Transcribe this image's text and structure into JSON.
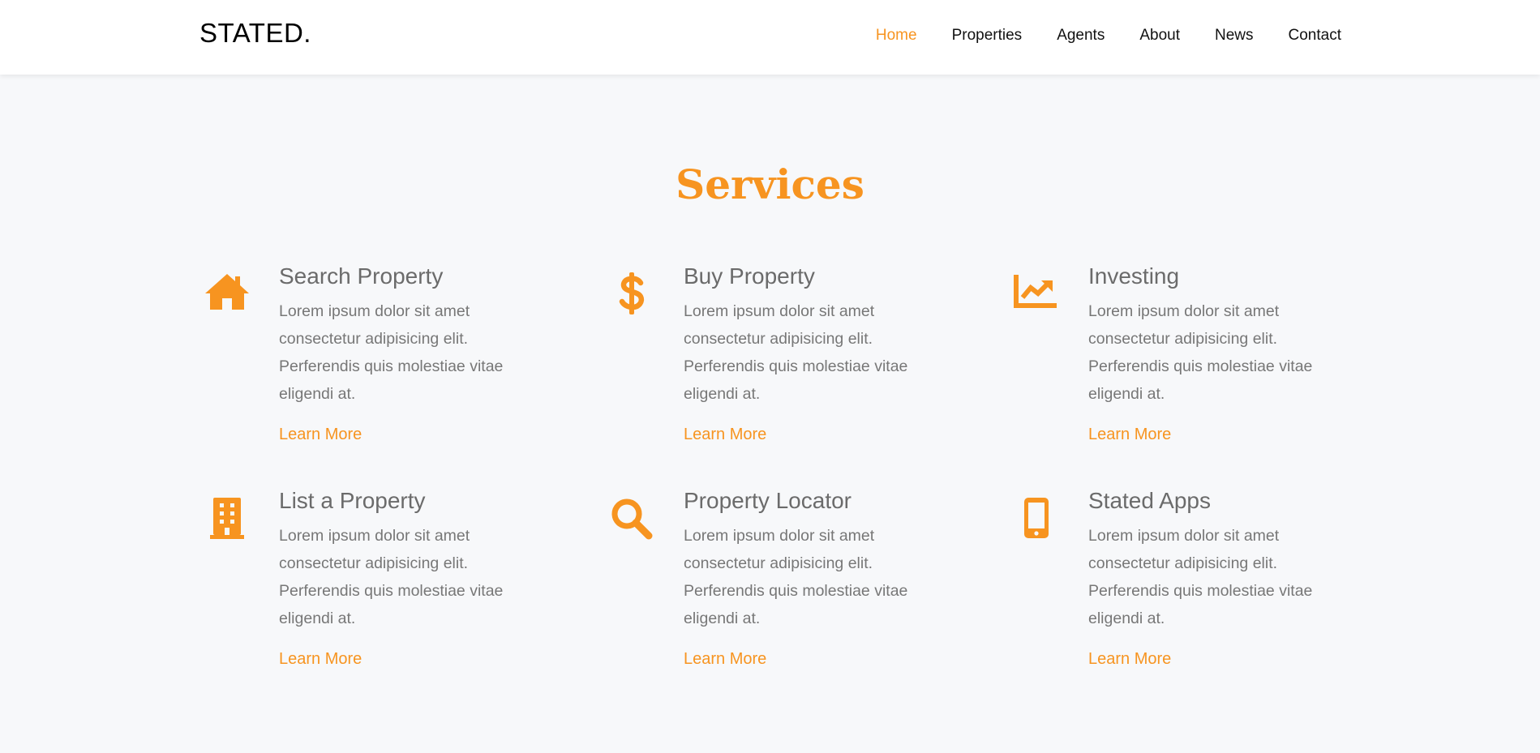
{
  "header": {
    "brand": "STATED.",
    "nav": [
      {
        "label": "Home",
        "active": true
      },
      {
        "label": "Properties",
        "active": false
      },
      {
        "label": "Agents",
        "active": false
      },
      {
        "label": "About",
        "active": false
      },
      {
        "label": "News",
        "active": false
      },
      {
        "label": "Contact",
        "active": false
      }
    ]
  },
  "theme": {
    "accent": "#f79420",
    "background": "#f7f8fa"
  },
  "services": {
    "title": "Services",
    "items": [
      {
        "icon": "home-icon",
        "title": "Search Property",
        "description": "Lorem ipsum dolor sit amet consectetur adipisicing elit. Perferendis quis molestiae vitae eligendi at.",
        "link": "Learn More"
      },
      {
        "icon": "dollar-icon",
        "title": "Buy Property",
        "description": "Lorem ipsum dolor sit amet consectetur adipisicing elit. Perferendis quis molestiae vitae eligendi at.",
        "link": "Learn More"
      },
      {
        "icon": "chart-line-icon",
        "title": "Investing",
        "description": "Lorem ipsum dolor sit amet consectetur adipisicing elit. Perferendis quis molestiae vitae eligendi at.",
        "link": "Learn More"
      },
      {
        "icon": "building-icon",
        "title": "List a Property",
        "description": "Lorem ipsum dolor sit amet consectetur adipisicing elit. Perferendis quis molestiae vitae eligendi at.",
        "link": "Learn More"
      },
      {
        "icon": "search-icon",
        "title": "Property Locator",
        "description": "Lorem ipsum dolor sit amet consectetur adipisicing elit. Perferendis quis molestiae vitae eligendi at.",
        "link": "Learn More"
      },
      {
        "icon": "mobile-icon",
        "title": "Stated Apps",
        "description": "Lorem ipsum dolor sit amet consectetur adipisicing elit. Perferendis quis molestiae vitae eligendi at.",
        "link": "Learn More"
      }
    ]
  }
}
